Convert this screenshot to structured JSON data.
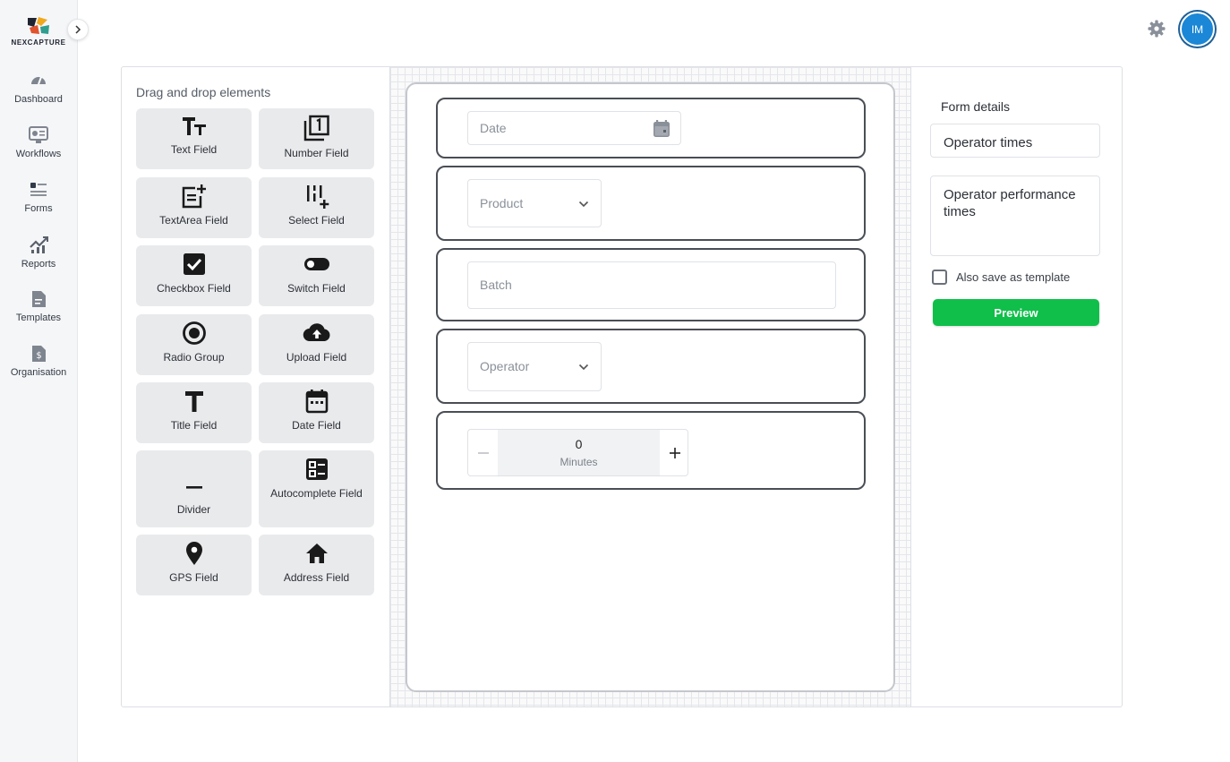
{
  "app": {
    "logo_text": "NEXCAPTURE",
    "user_initials": "IM",
    "accent_color": "#1b87d6",
    "brand_colors": [
      "#1f2430",
      "#f0a81c",
      "#e0532c",
      "#2f9e8f"
    ]
  },
  "sidebar": {
    "items": [
      {
        "label": "Dashboard",
        "icon": "dashboard-gauge-icon"
      },
      {
        "label": "Workflows",
        "icon": "workflows-icon"
      },
      {
        "label": "Forms",
        "icon": "forms-icon"
      },
      {
        "label": "Reports",
        "icon": "reports-chart-icon"
      },
      {
        "label": "Templates",
        "icon": "templates-document-icon"
      },
      {
        "label": "Organisation",
        "icon": "organisation-dollar-icon"
      }
    ]
  },
  "palette": {
    "title": "Drag and drop elements",
    "elements": [
      {
        "label": "Text Field",
        "icon": "text-field-icon"
      },
      {
        "label": "Number Field",
        "icon": "number-field-icon"
      },
      {
        "label": "TextArea Field",
        "icon": "textarea-field-icon"
      },
      {
        "label": "Select Field",
        "icon": "select-field-icon"
      },
      {
        "label": "Checkbox Field",
        "icon": "checkbox-field-icon"
      },
      {
        "label": "Switch Field",
        "icon": "switch-field-icon"
      },
      {
        "label": "Radio Group",
        "icon": "radio-group-icon"
      },
      {
        "label": "Upload Field",
        "icon": "upload-cloud-icon"
      },
      {
        "label": "Title Field",
        "icon": "title-field-icon"
      },
      {
        "label": "Date Field",
        "icon": "calendar-icon"
      },
      {
        "label": "Divider",
        "icon": "divider-icon"
      },
      {
        "label": "Autocomplete Field",
        "icon": "autocomplete-field-icon"
      },
      {
        "label": "GPS Field",
        "icon": "location-pin-icon"
      },
      {
        "label": "Address Field",
        "icon": "home-icon"
      }
    ]
  },
  "canvas": {
    "fields": {
      "date": {
        "placeholder": "Date"
      },
      "product": {
        "placeholder": "Product"
      },
      "batch": {
        "placeholder": "Batch"
      },
      "operator": {
        "placeholder": "Operator"
      },
      "minutes": {
        "value": "0",
        "unit": "Minutes"
      }
    }
  },
  "details": {
    "title": "Form details",
    "form_name": "Operator times",
    "form_description": "Operator performance times",
    "save_template_label": "Also save as template",
    "save_template_checked": false,
    "preview_label": "Preview",
    "preview_color": "#0fbf4a"
  }
}
